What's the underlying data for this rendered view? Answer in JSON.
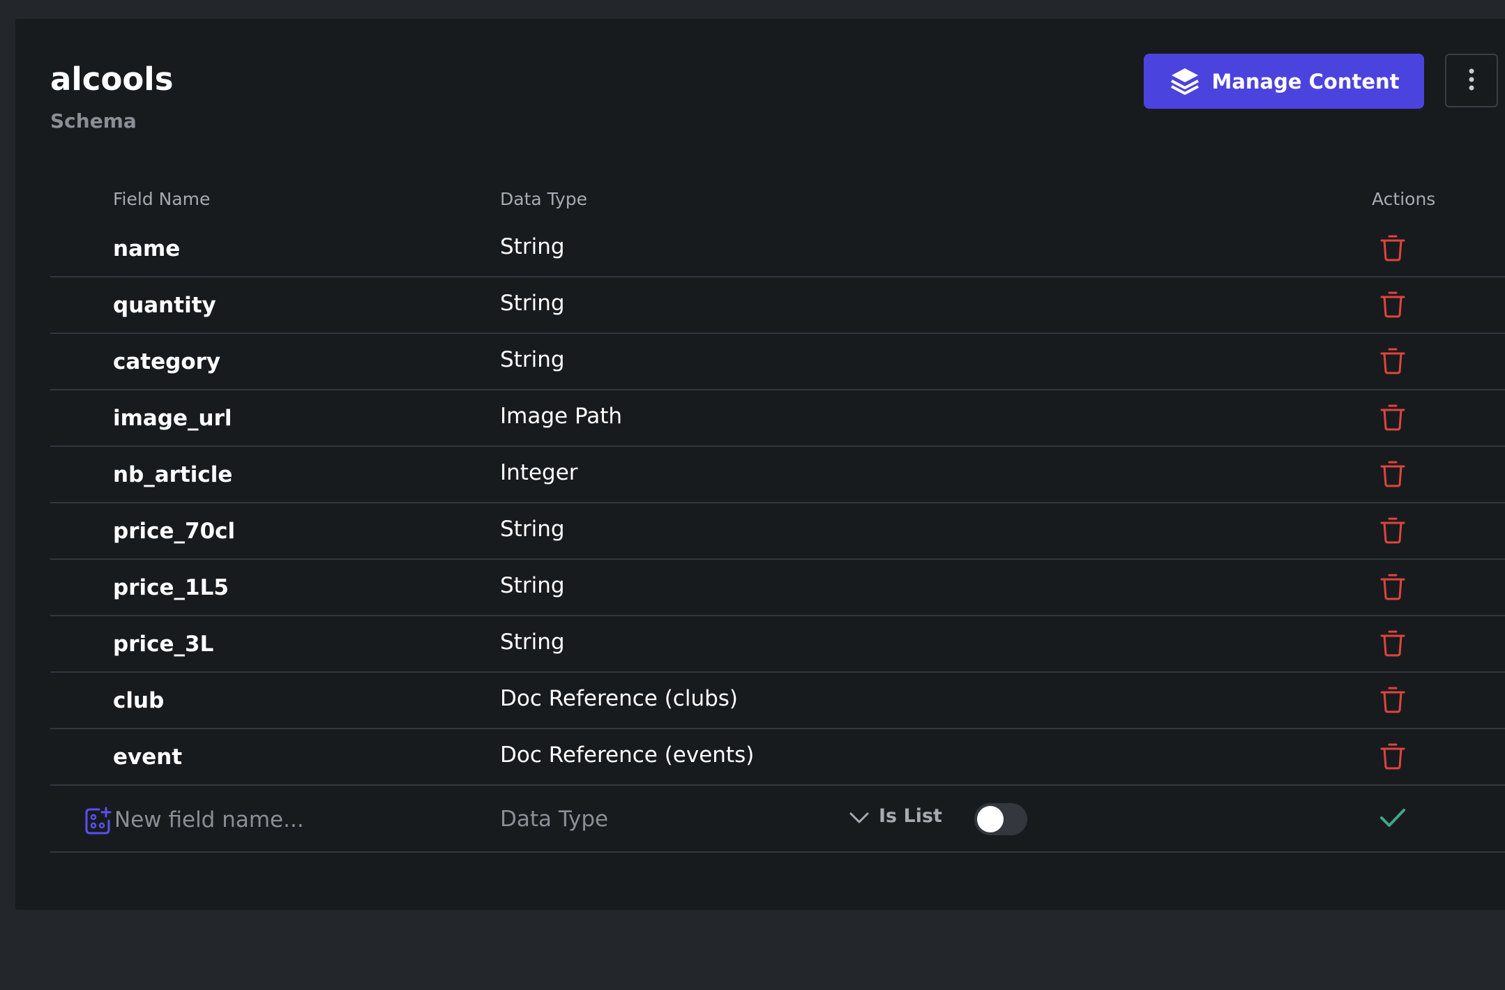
{
  "header": {
    "title": "alcools",
    "subtitle": "Schema",
    "manage_label": "Manage Content"
  },
  "table": {
    "columns": {
      "field_name": "Field Name",
      "data_type": "Data Type",
      "actions": "Actions"
    },
    "rows": [
      {
        "name": "name",
        "type": "String"
      },
      {
        "name": "quantity",
        "type": "String"
      },
      {
        "name": "category",
        "type": "String"
      },
      {
        "name": "image_url",
        "type": "Image Path"
      },
      {
        "name": "nb_article",
        "type": "Integer"
      },
      {
        "name": "price_70cl",
        "type": "String"
      },
      {
        "name": "price_1L5",
        "type": "String"
      },
      {
        "name": "price_3L",
        "type": "String"
      },
      {
        "name": "club",
        "type": "Doc Reference (clubs)"
      },
      {
        "name": "event",
        "type": "Doc Reference (events)"
      }
    ]
  },
  "new_field": {
    "placeholder": "New field name...",
    "data_type_placeholder": "Data Type",
    "is_list_label": "Is List",
    "is_list": false
  },
  "icons": {
    "manage": "layers-icon",
    "more": "more-vertical-icon",
    "delete": "trash-icon",
    "add_field": "add-field-icon",
    "dropdown": "chevron-down-icon",
    "confirm": "check-icon"
  },
  "colors": {
    "accent": "#4b43dd",
    "danger": "#e0443d",
    "success": "#3fa68d"
  }
}
